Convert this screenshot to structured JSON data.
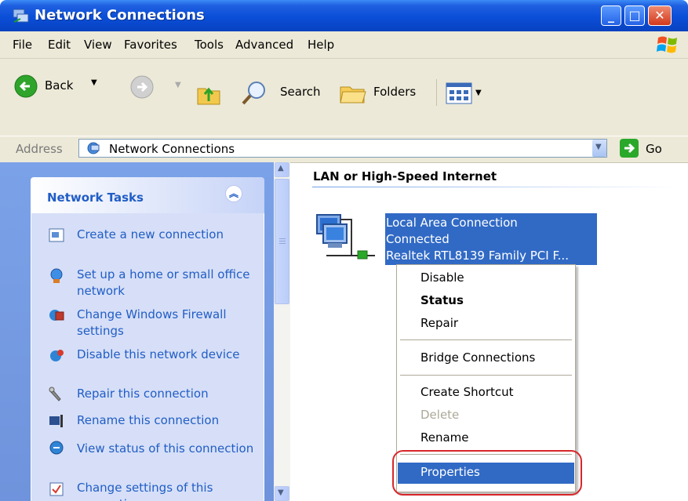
{
  "window": {
    "title": "Network Connections"
  },
  "menu": [
    "File",
    "Edit",
    "View",
    "Favorites",
    "Tools",
    "Advanced",
    "Help"
  ],
  "toolbar": {
    "back": "Back",
    "search": "Search",
    "folders": "Folders"
  },
  "address": {
    "label": "Address",
    "value": "Network Connections",
    "go": "Go"
  },
  "tasks": {
    "title": "Network Tasks",
    "items": [
      "Create a new connection",
      "Set up a home or small office network",
      "Change Windows Firewall settings",
      "Disable this network device",
      "Repair this connection",
      "Rename this connection",
      "View status of this connection",
      "Change settings of this connection"
    ]
  },
  "content": {
    "group_header": "LAN or High-Speed Internet",
    "connection": {
      "name": "Local Area Connection",
      "status": "Connected",
      "device": "Realtek RTL8139 Family PCI F..."
    }
  },
  "context_menu": {
    "items": [
      "Disable",
      "Status",
      "Repair",
      "Bridge Connections",
      "Create Shortcut",
      "Delete",
      "Rename",
      "Properties"
    ],
    "selected": "Properties"
  },
  "colors": {
    "xp_blue": "#0a4ed8",
    "selection": "#316ac5",
    "task_link": "#215dc6",
    "highlight_circle": "#d8262a"
  }
}
